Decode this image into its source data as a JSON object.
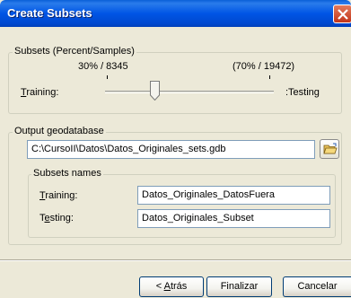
{
  "window": {
    "title": "Create Subsets"
  },
  "subsets": {
    "legend": "Subsets (Percent/Samples)",
    "training_value": "30% / 8345",
    "testing_value": "(70% / 19472)",
    "training_label_pre": "",
    "training_label_key": "T",
    "training_label_post": "raining:",
    "testing_label": ":Testing",
    "training_percent": 30
  },
  "output": {
    "legend": "Output geodatabase",
    "path": "C:\\CursoII\\Datos\\Datos_Originales_sets.gdb",
    "browse_icon": "open-folder-icon"
  },
  "names": {
    "legend": "Subsets names",
    "training_key": "T",
    "training_rest": "raining:",
    "training_value": "Datos_Originales_DatosFuera",
    "testing_pre": "T",
    "testing_key": "e",
    "testing_rest": "sting:",
    "testing_value": "Datos_Originales_Subset"
  },
  "buttons": {
    "back_pre": "< ",
    "back_key": "A",
    "back_rest": "trás",
    "finish": "Finalizar",
    "cancel": "Cancelar"
  },
  "colors": {
    "titlebar": "#0055E5",
    "face": "#ECE9D8",
    "close": "#C2351A"
  }
}
